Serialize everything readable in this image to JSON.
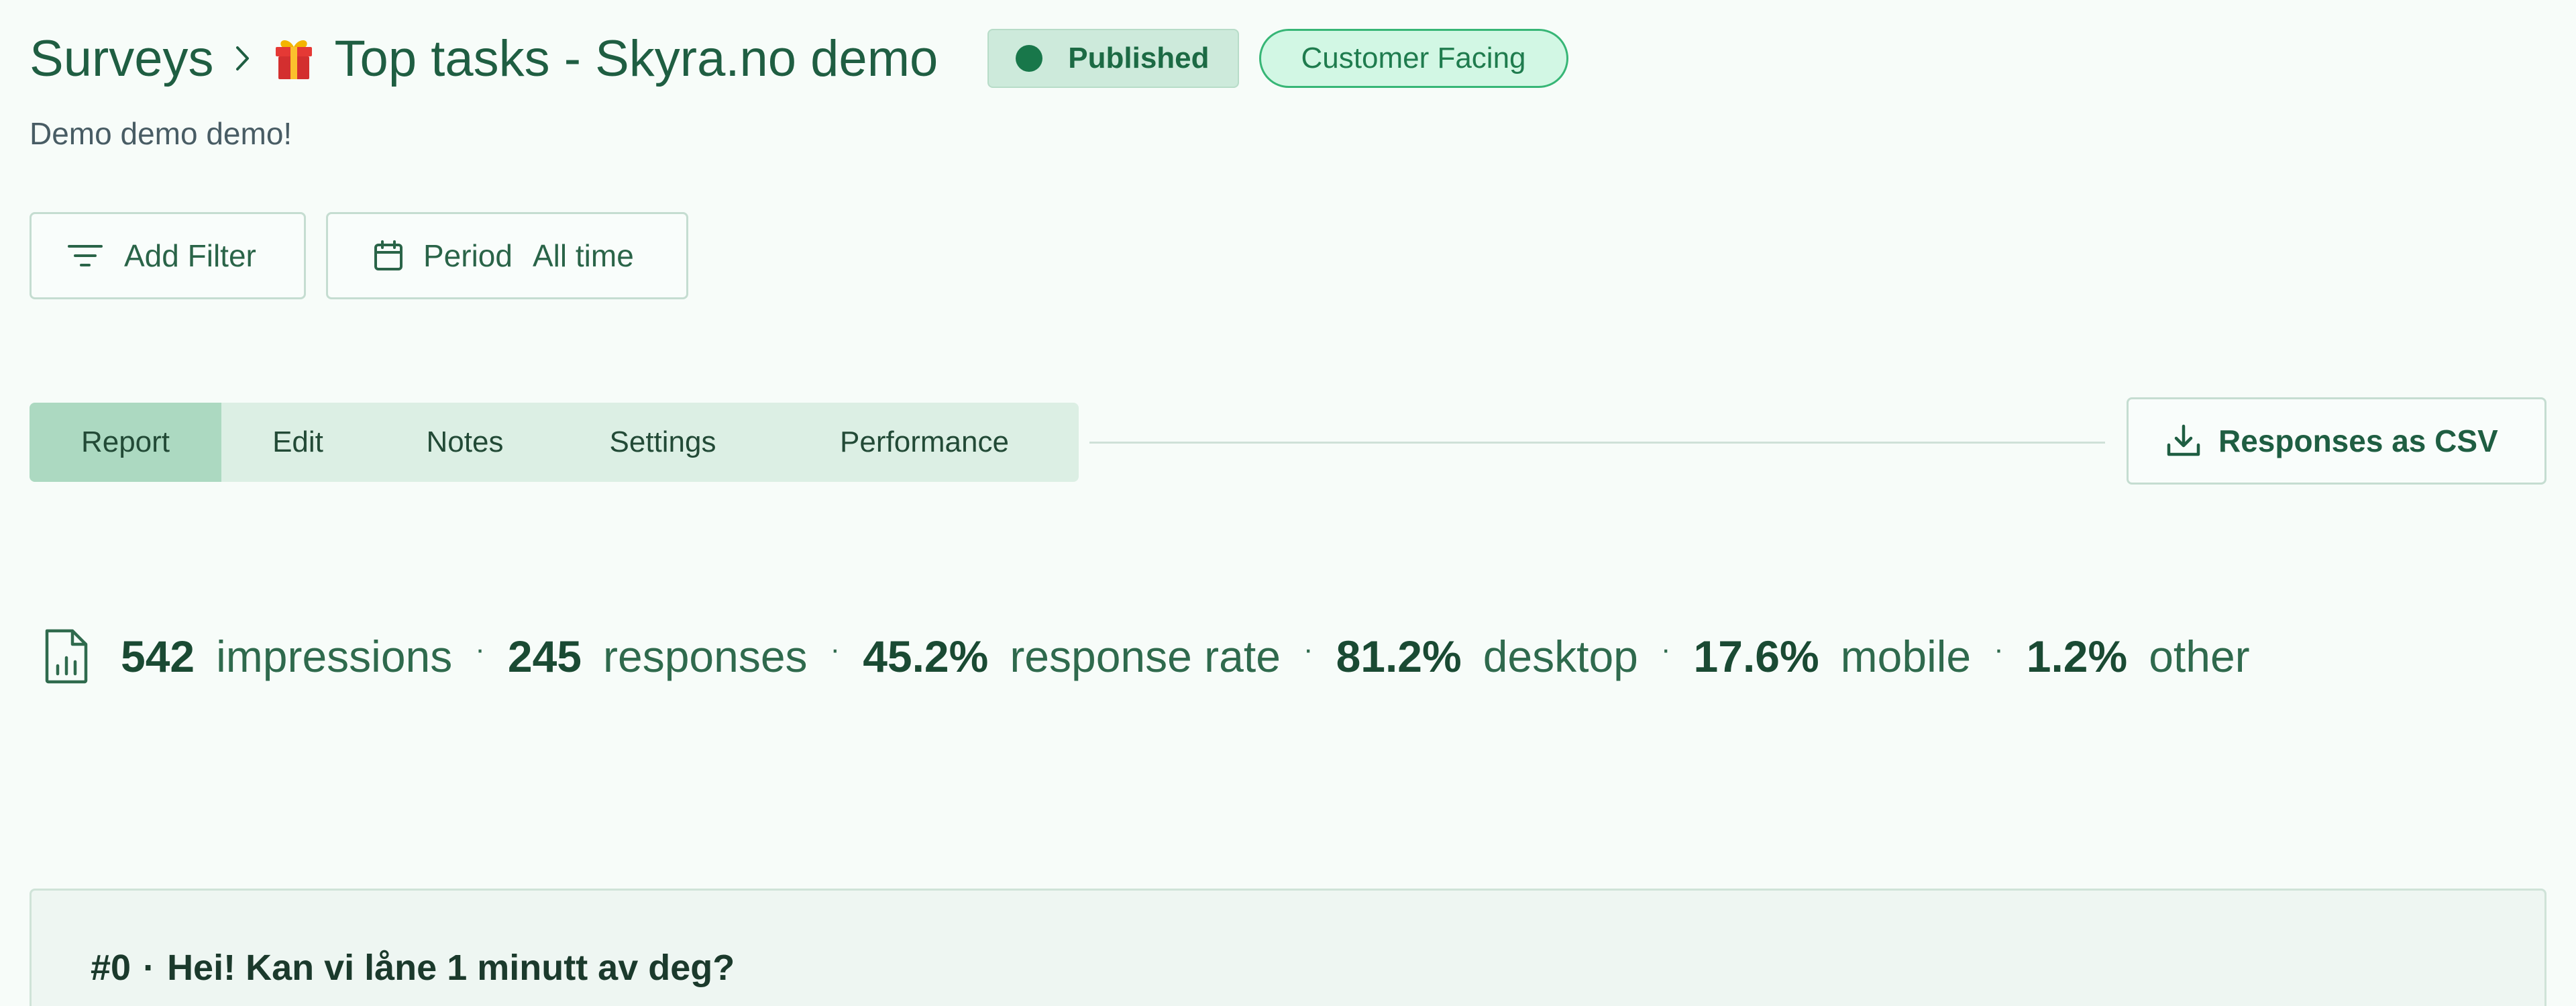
{
  "header": {
    "breadcrumb": "Surveys",
    "title": "Top tasks - Skyra.no demo",
    "status_badge": "Published",
    "tag_badge": "Customer Facing",
    "subtitle": "Demo demo demo!"
  },
  "filters": {
    "add_filter_label": "Add Filter",
    "period_label": "Period",
    "period_value": "All time"
  },
  "tabs": [
    {
      "label": "Report",
      "active": true
    },
    {
      "label": "Edit",
      "active": false
    },
    {
      "label": "Notes",
      "active": false
    },
    {
      "label": "Settings",
      "active": false
    },
    {
      "label": "Performance",
      "active": false
    }
  ],
  "export": {
    "label": "Responses as CSV"
  },
  "stats": {
    "impressions": {
      "value": "542",
      "label": "impressions"
    },
    "responses": {
      "value": "245",
      "label": "responses"
    },
    "response_rate": {
      "value": "45.2%",
      "label": "response rate"
    },
    "desktop": {
      "value": "81.2%",
      "label": "desktop"
    },
    "mobile": {
      "value": "17.6%",
      "label": "mobile"
    },
    "other": {
      "value": "1.2%",
      "label": "other"
    },
    "separator": "·"
  },
  "question": {
    "number": "#0",
    "separator": "·",
    "text": "Hei! Kan vi låne 1 minutt av deg?"
  },
  "icons": [
    "chevron-right-icon",
    "gift-icon",
    "filter-icon",
    "calendar-icon",
    "download-icon",
    "report-chart-icon"
  ],
  "colors": {
    "background": "#f7fcf9",
    "primary_text": "#1f5e42",
    "published_badge_bg": "#cdeadb",
    "tag_badge_border": "#37b676",
    "active_tab_bg": "#acd9c1"
  }
}
